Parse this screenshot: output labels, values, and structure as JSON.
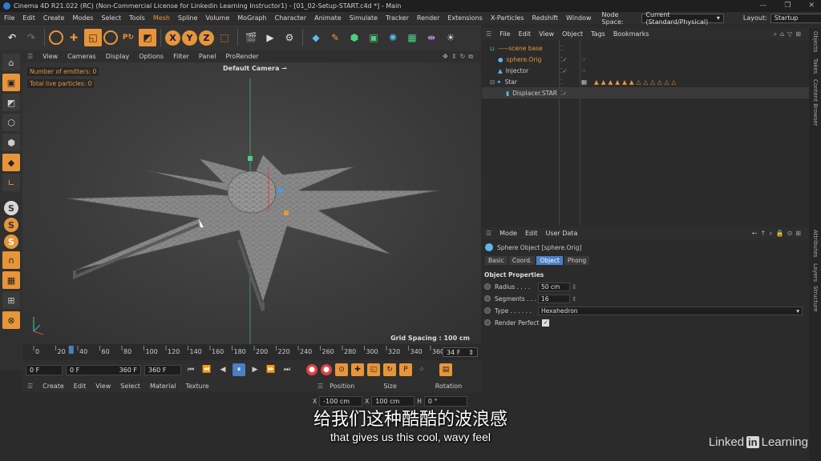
{
  "window": {
    "title": "Cinema 4D R21.022 (RC) (Non-Commercial License for Linkedin Learning Instructor1) - [01_02-Setup-START.c4d *] - Main"
  },
  "menubar": {
    "items": [
      "File",
      "Edit",
      "Create",
      "Modes",
      "Select",
      "Tools",
      "Mesh",
      "Spline",
      "Volume",
      "MoGraph",
      "Character",
      "Animate",
      "Simulate",
      "Tracker",
      "Render",
      "Extensions",
      "X-Particles",
      "Redshift",
      "Window"
    ],
    "node_space_label": "Node Space:",
    "node_space_value": "Current (Standard/Physical)",
    "layout_label": "Layout:",
    "layout_value": "Startup"
  },
  "viewport": {
    "menu": [
      "View",
      "Cameras",
      "Display",
      "Options",
      "Filter",
      "Panel",
      "ProRender"
    ],
    "camera_label": "Default Camera",
    "hud_emitters": "Number of emitters: 0",
    "hud_particles": "Total live particles: 0",
    "grid_spacing": "Grid Spacing : 100 cm"
  },
  "timeline": {
    "ticks": [
      "0",
      "20",
      "40",
      "60",
      "80",
      "100",
      "120",
      "140",
      "160",
      "180",
      "200",
      "220",
      "240",
      "260",
      "280",
      "300",
      "320",
      "340",
      "360"
    ],
    "current_frame": "34 F"
  },
  "playback": {
    "start_frame": "0 F",
    "min_frame": "0 F",
    "max_frame": "360 F",
    "end_frame": "360 F"
  },
  "material_manager": {
    "menu": [
      "Create",
      "Edit",
      "View",
      "Select",
      "Material",
      "Texture"
    ]
  },
  "coordinates": {
    "headers": [
      "Position",
      "Size",
      "Rotation"
    ],
    "x_label": "X",
    "pos_x": "-100 cm",
    "size_x": "100 cm",
    "h_label": "H",
    "rot_h": "0 °"
  },
  "object_manager": {
    "menu": [
      "File",
      "Edit",
      "View",
      "Object",
      "Tags",
      "Bookmarks"
    ],
    "objects": [
      {
        "name": "-----scene base"
      },
      {
        "name": "sphere.Orig"
      },
      {
        "name": "Injector"
      },
      {
        "name": "Star"
      },
      {
        "name": "Displacer.STAR"
      }
    ]
  },
  "attributes": {
    "menu": [
      "Mode",
      "Edit",
      "User Data"
    ],
    "object_title": "Sphere Object [sphere.Orig]",
    "tabs": [
      "Basic",
      "Coord.",
      "Object",
      "Phong"
    ],
    "active_tab": "Object",
    "section_title": "Object Properties",
    "radius_label": "Radius . . . .",
    "radius_value": "50 cm",
    "segments_label": "Segments . . .",
    "segments_value": "16",
    "type_label": "Type . . . . . .",
    "type_value": "Hexahedron",
    "render_perfect_label": "Render Perfect"
  },
  "right_tabs": [
    "Objects",
    "Takes",
    "Content Browser",
    "Attributes",
    "Layers",
    "Structure"
  ],
  "subtitles": {
    "chinese": "给我们这种酷酷的波浪感",
    "english": "that gives us this cool, wavy feel"
  },
  "watermark": {
    "linked": "Linked",
    "in": "in",
    "learning": "Learning"
  },
  "colors": {
    "accent_orange": "#e8953a",
    "selection_blue": "#4a7fc6",
    "background": "#2b2b2b"
  }
}
